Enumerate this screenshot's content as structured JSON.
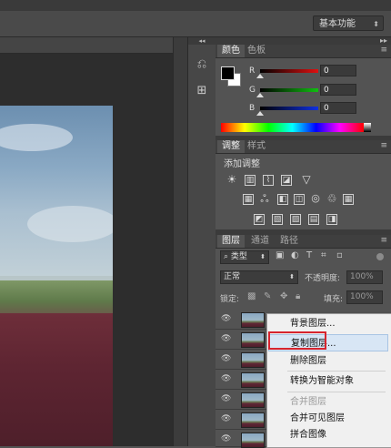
{
  "workspace": {
    "label": "基本功能"
  },
  "color_panel": {
    "tabs": [
      "颜色",
      "色板"
    ],
    "sliders": [
      {
        "label": "R",
        "value": "0",
        "color": "#e01010"
      },
      {
        "label": "G",
        "value": "0",
        "color": "#10c010"
      },
      {
        "label": "B",
        "value": "0",
        "color": "#1030e0"
      }
    ],
    "foreground": "#000000",
    "background": "#ffffff"
  },
  "adjustments_panel": {
    "tabs": [
      "调整",
      "样式"
    ],
    "heading": "添加调整",
    "icons": [
      [
        "brightness-icon",
        "levels-icon",
        "curves-icon",
        "exposure-icon",
        "triangle-icon"
      ],
      [
        "vibrance-icon",
        "hue-icon",
        "color-balance-icon",
        "bw-icon",
        "photo-filter-icon",
        "channel-mixer-icon",
        "lookup-icon"
      ],
      [
        "invert-icon",
        "posterize-icon",
        "threshold-icon",
        "gradient-map-icon",
        "selective-color-icon"
      ]
    ]
  },
  "layers_panel": {
    "tabs": [
      "图层",
      "通道",
      "路径"
    ],
    "filter_label": "类型",
    "blend_mode": "正常",
    "opacity_label": "不透明度:",
    "opacity_value": "100%",
    "lock_label": "锁定:",
    "fill_label": "填充:",
    "fill_value": "100%",
    "row_count_visible": 7
  },
  "context_menu": {
    "items": [
      {
        "label": "背景图层...",
        "disabled": false
      },
      {
        "label": "复制图层...",
        "disabled": false,
        "highlighted": true
      },
      {
        "label": "删除图层",
        "disabled": false
      },
      {
        "label": "转换为智能对象",
        "disabled": false
      },
      {
        "label": "合并图层",
        "disabled": true
      },
      {
        "label": "合并可见图层",
        "disabled": false
      },
      {
        "label": "拼合图像",
        "disabled": false
      }
    ]
  }
}
